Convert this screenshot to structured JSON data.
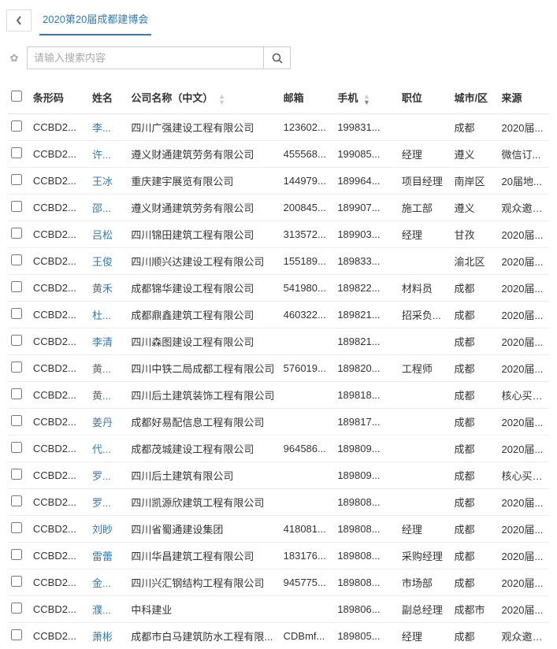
{
  "tab_title": "2020第20届成都建博会",
  "search_placeholder": "请输入搜索内容",
  "columns": {
    "barcode": "条形码",
    "name": "姓名",
    "company": "公司名称（中文）",
    "email": "邮箱",
    "phone": "手机",
    "position": "职位",
    "city": "城市/区",
    "source": "来源"
  },
  "rows": [
    {
      "barcode": "CCBD2...",
      "name": "李...",
      "company": "四川广强建设工程有限公司",
      "email": "123602...",
      "phone": "199831...",
      "position": "",
      "city": "成都",
      "source": "2020届..."
    },
    {
      "barcode": "CCBD2...",
      "name": "许...",
      "company": "遵义财通建筑劳务有限公司",
      "email": "455568...",
      "phone": "199085...",
      "position": "经理",
      "city": "遵义",
      "source": "微信订..."
    },
    {
      "barcode": "CCBD2...",
      "name": "王冰",
      "company": "重庆建宇展览有限公司",
      "email": "144979...",
      "phone": "189964...",
      "position": "项目经理",
      "city": "南岸区",
      "source": "20届地..."
    },
    {
      "barcode": "CCBD2...",
      "name": "邵...",
      "company": "遵义财通建筑劳务有限公司",
      "email": "200845...",
      "phone": "189907...",
      "position": "施工部",
      "city": "遵义",
      "source": "观众邀请..."
    },
    {
      "barcode": "CCBD2...",
      "name": "吕松",
      "company": "四川锦田建筑工程有限公司",
      "email": "313572...",
      "phone": "189903...",
      "position": "经理",
      "city": "甘孜",
      "source": "2020届..."
    },
    {
      "barcode": "CCBD2...",
      "name": "王俊",
      "company": "四川顺兴达建设工程有限公司",
      "email": "155189...",
      "phone": "189833...",
      "position": "",
      "city": "渝北区",
      "source": "2020届..."
    },
    {
      "barcode": "CCBD2...",
      "name": "黄禾",
      "company": "成都锦华建设工程有限公司",
      "email": "541980...",
      "phone": "189822...",
      "position": "材料员",
      "city": "成都",
      "source": "2020届..."
    },
    {
      "barcode": "CCBD2...",
      "name": "杜...",
      "company": "成都鼎鑫建筑工程有限公司",
      "email": "460322...",
      "phone": "189821...",
      "position": "招采负...",
      "city": "成都",
      "source": "2020届..."
    },
    {
      "barcode": "CCBD2...",
      "name": "李清",
      "company": "四川森图建设工程有限公司",
      "email": "",
      "phone": "189821...",
      "position": "",
      "city": "成都",
      "source": "2020届..."
    },
    {
      "barcode": "CCBD2...",
      "name": "黄...",
      "company": "四川中铁二局成都工程有限公司",
      "email": "576019...",
      "phone": "189820...",
      "position": "工程师",
      "city": "成都",
      "source": "2020届..."
    },
    {
      "barcode": "CCBD2...",
      "name": "黄...",
      "company": "四川后土建筑装饰工程有限公司",
      "email": "",
      "phone": "189818...",
      "position": "",
      "city": "成都",
      "source": "核心买家..."
    },
    {
      "barcode": "CCBD2...",
      "name": "姜丹",
      "company": "成都好易配信息工程有限公司",
      "email": "",
      "phone": "189817...",
      "position": "",
      "city": "成都",
      "source": "2020届..."
    },
    {
      "barcode": "CCBD2...",
      "name": "代...",
      "company": "成都茂城建设工程有限公司",
      "email": "964586...",
      "phone": "189809...",
      "position": "",
      "city": "成都",
      "source": "2020届..."
    },
    {
      "barcode": "CCBD2...",
      "name": "罗...",
      "company": "四川后土建筑有限公司",
      "email": "",
      "phone": "189809...",
      "position": "",
      "city": "成都",
      "source": "核心买家..."
    },
    {
      "barcode": "CCBD2...",
      "name": "罗...",
      "company": "四川凯源欣建筑工程有限公司",
      "email": "",
      "phone": "189808...",
      "position": "",
      "city": "成都",
      "source": "2020届..."
    },
    {
      "barcode": "CCBD2...",
      "name": "刘眇",
      "company": "四川省蜀通建设集团",
      "email": "418081...",
      "phone": "189808...",
      "position": "经理",
      "city": "成都",
      "source": "2020届..."
    },
    {
      "barcode": "CCBD2...",
      "name": "雷蕾",
      "company": "四川华昌建筑工程有限公司",
      "email": "183176...",
      "phone": "189808...",
      "position": "采购经理",
      "city": "成都",
      "source": "2020届..."
    },
    {
      "barcode": "CCBD2...",
      "name": "金...",
      "company": "四川兴汇钢结构工程有限公司",
      "email": "945775...",
      "phone": "189808...",
      "position": "市场部",
      "city": "成都",
      "source": "2020届..."
    },
    {
      "barcode": "CCBD2...",
      "name": "濮...",
      "company": "中科建业",
      "email": "",
      "phone": "189806...",
      "position": "副总经理",
      "city": "成都市",
      "source": "2020届..."
    },
    {
      "barcode": "CCBD2...",
      "name": "萧彬",
      "company": "成都市白马建筑防水工程有限...",
      "email": "CDBmf...",
      "phone": "189805...",
      "position": "经理",
      "city": "成都",
      "source": "观众邀请..."
    }
  ]
}
